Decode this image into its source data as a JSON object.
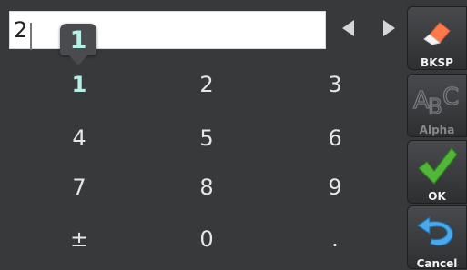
{
  "entry": {
    "value": "2"
  },
  "popup": {
    "digit": "1"
  },
  "keys": [
    "1",
    "2",
    "3",
    "4",
    "5",
    "6",
    "7",
    "8",
    "9",
    "±",
    "0",
    "."
  ],
  "side_buttons": {
    "backspace": "BKSP",
    "alpha": "Alpha",
    "ok": "OK",
    "cancel": "Cancel"
  }
}
